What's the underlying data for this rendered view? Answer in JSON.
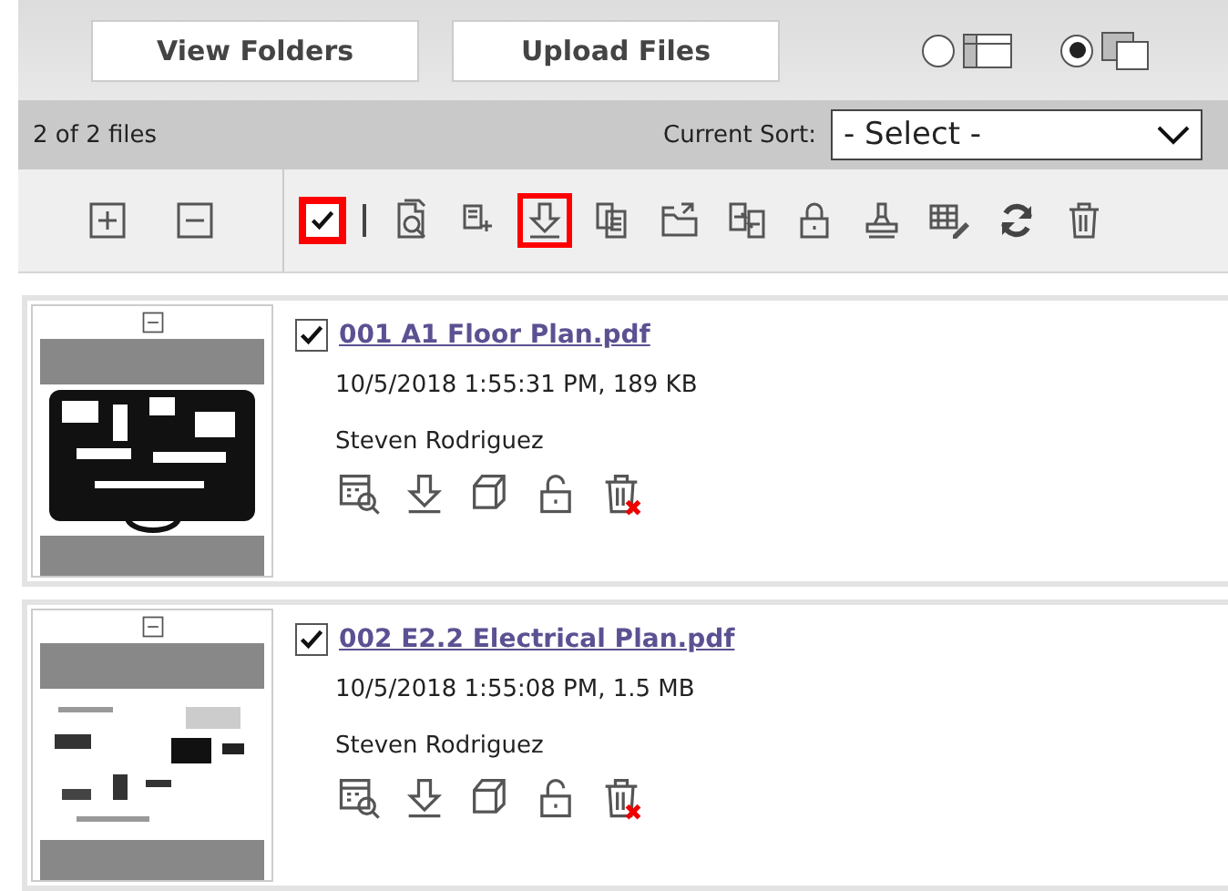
{
  "view_buttons": [
    {
      "label": "View Folders"
    },
    {
      "label": "Upload Files"
    }
  ],
  "layout_options": [
    {
      "kind": "list",
      "selected": false
    },
    {
      "kind": "tiles",
      "selected": true
    }
  ],
  "file_count": "2 of 2 files",
  "sort": {
    "label": "Current Sort:",
    "value": "- Select -"
  },
  "toolbar": {
    "tree_tools": [
      {
        "kind": "expand"
      },
      {
        "kind": "collapse"
      }
    ],
    "select_all": {
      "checked": true,
      "highlighted": true
    },
    "tools": [
      {
        "kind": "preview",
        "highlighted": false
      },
      {
        "kind": "add",
        "highlighted": false
      },
      {
        "kind": "download",
        "highlighted": true
      },
      {
        "kind": "copy",
        "highlighted": false
      },
      {
        "kind": "move",
        "highlighted": false
      },
      {
        "kind": "merge",
        "highlighted": false
      },
      {
        "kind": "lock",
        "highlighted": false
      },
      {
        "kind": "stamp",
        "highlighted": false
      },
      {
        "kind": "edit",
        "highlighted": false
      },
      {
        "kind": "refresh",
        "highlighted": false
      },
      {
        "kind": "delete",
        "highlighted": false
      }
    ]
  },
  "files": [
    {
      "expanded": true,
      "checked": true,
      "name": "001 A1 Floor Plan.pdf",
      "details": "10/5/2018 1:55:31 PM, 189 KB",
      "owner": "Steven Rodriguez",
      "actions": [
        {
          "kind": "details"
        },
        {
          "kind": "download"
        },
        {
          "kind": "duplicate"
        },
        {
          "kind": "unlock"
        },
        {
          "kind": "delete"
        }
      ]
    },
    {
      "expanded": true,
      "checked": true,
      "name": "002 E2.2 Electrical Plan.pdf",
      "details": "10/5/2018 1:55:08 PM, 1.5 MB",
      "owner": "Steven Rodriguez",
      "actions": [
        {
          "kind": "details"
        },
        {
          "kind": "download"
        },
        {
          "kind": "duplicate"
        },
        {
          "kind": "unlock"
        },
        {
          "kind": "delete"
        }
      ]
    }
  ]
}
